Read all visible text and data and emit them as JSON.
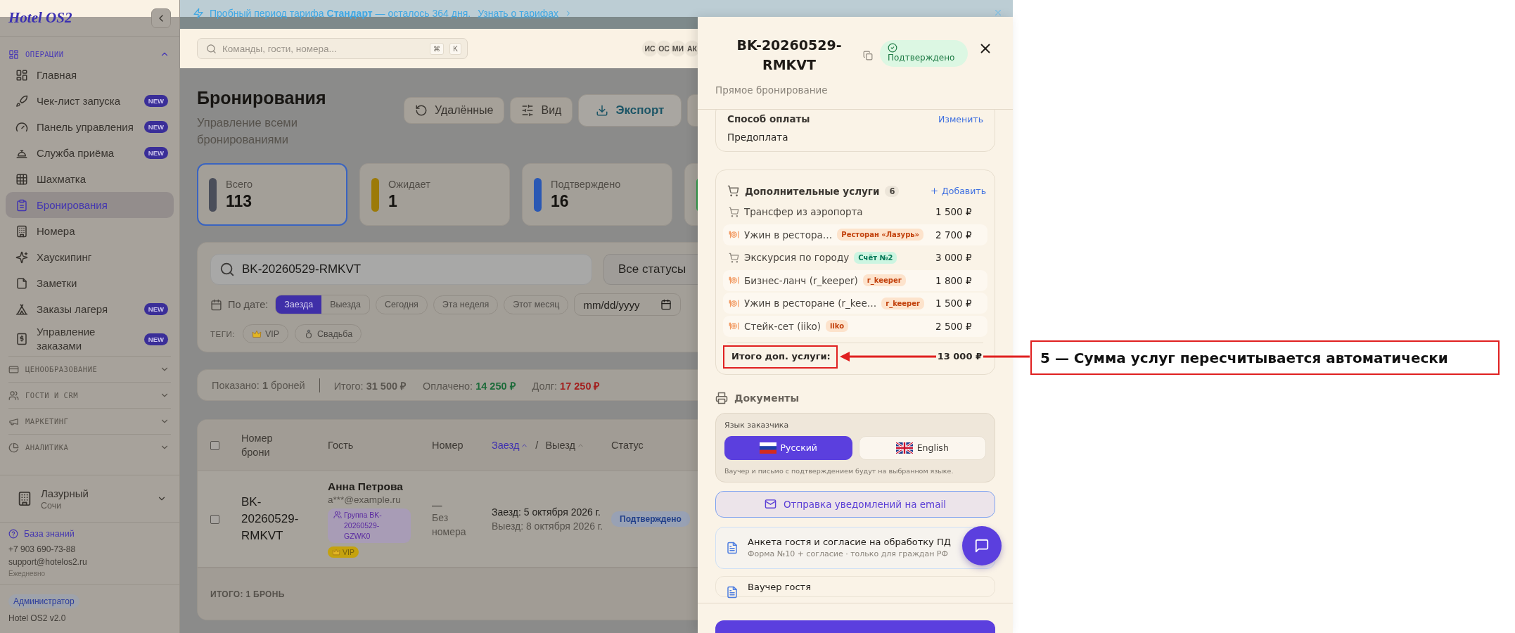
{
  "banner": {
    "text": "Пробный период тарифа **Стандарт** — осталось 364 дня.",
    "link": "Узнать о тарифах"
  },
  "sidebar": {
    "logo": "Hotel OS2",
    "sections": [
      {
        "label": "ОПЕРАЦИИ",
        "expanded": true,
        "items": [
          {
            "label": "Главная",
            "selected": false
          },
          {
            "label": "Чек-лист запуска",
            "selected": false,
            "badge": "NEW"
          },
          {
            "label": "Панель управления",
            "selected": false,
            "badge": "NEW"
          },
          {
            "label": "Служба приёма",
            "selected": false,
            "badge": "NEW"
          },
          {
            "label": "Шахматка",
            "selected": false
          },
          {
            "label": "Бронирования",
            "selected": true
          },
          {
            "label": "Номера",
            "selected": false
          },
          {
            "label": "Хаускипинг",
            "selected": false
          },
          {
            "label": "Заметки",
            "selected": false
          },
          {
            "label": "Заказы лагеря",
            "selected": false,
            "badge": "NEW"
          },
          {
            "label": "Управление заказами",
            "selected": false,
            "badge": "NEW"
          }
        ]
      },
      {
        "label": "ЦЕНООБРАЗОВАНИЕ",
        "expanded": false
      },
      {
        "label": "ГОСТИ И CRM",
        "expanded": false
      },
      {
        "label": "МАРКЕТИНГ",
        "expanded": false
      },
      {
        "label": "АНАЛИТИКА",
        "expanded": false
      }
    ],
    "property": {
      "name": "Лазурный",
      "city": "Сочи"
    },
    "support": {
      "link": "База знаний",
      "phone": "+7 903 690-73-88",
      "email": "support@hotelos2.ru",
      "hours": "Ежедневно"
    },
    "role": "Администратор",
    "version": "Hotel OS2 v2.0"
  },
  "topbar": {
    "search_placeholder": "Команды, гости, номера...",
    "keys": [
      "⌘",
      "K"
    ],
    "avatars": [
      "ИС",
      "ОС",
      "МИ",
      "АК"
    ]
  },
  "page": {
    "title": "Бронирования",
    "subtitle": "Управление всеми бронированиями",
    "actions": [
      {
        "kind": "restore",
        "label": "Удалённые"
      },
      {
        "kind": "view",
        "label": "Вид"
      },
      {
        "kind": "export",
        "label": "Экспорт"
      },
      {
        "kind": "more"
      }
    ]
  },
  "stats": [
    {
      "label": "Всего",
      "value": "113",
      "color": "#4a4e5a",
      "selected": true
    },
    {
      "label": "Ожидает",
      "value": "1",
      "color": "#9c7a08",
      "selected": false
    },
    {
      "label": "Подтверждено",
      "value": "16",
      "color": "#2a58b4",
      "selected": false
    },
    {
      "color": "#2f9a4a",
      "selected": false
    }
  ],
  "filters": {
    "search": "BK-20260529-RMKVT",
    "status": "Все статусы",
    "date_label": "По дате:",
    "date_modes": [
      {
        "label": "Заезда",
        "selected": true
      },
      {
        "label": "Выезда",
        "selected": false
      }
    ],
    "presets": [
      "Сегодня",
      "Эта неделя",
      "Этот месяц"
    ],
    "date_placeholder": "mm/dd/yyyy",
    "tags_label": "ТЕГИ:",
    "tags": [
      "VIP",
      "Свадьба"
    ]
  },
  "summary": [
    {
      "text": "Показано: **1** броней"
    },
    {
      "text": "Итого: **31 500 ₽**"
    },
    {
      "text": "Оплачено: **14 250 ₽**",
      "color": "#1d6b3a"
    },
    {
      "text": "Долг: **17 250 ₽**",
      "color": "#a3201f"
    }
  ],
  "table": {
    "columns": [
      {
        "kind": "check",
        "checked": false
      },
      {
        "kind": "text",
        "label": "Номер брони"
      },
      {
        "kind": "text",
        "label": "Гость"
      },
      {
        "kind": "text",
        "label": "Номер"
      },
      {
        "kind": "sort",
        "options": [
          {
            "label": "Заезд",
            "selected": true
          },
          {
            "label": "Выезд",
            "selected": false
          }
        ],
        "separator": "/"
      },
      {
        "kind": "text",
        "label": "Статус"
      }
    ],
    "rows": [
      {
        "checked": false,
        "booking": "BK-20260529-RMKVT",
        "guest": {
          "name": "Анна Петрова",
          "email": "a***@example.ru",
          "group": "Группа BK-20260529-GZWK0",
          "tags": [
            "VIP"
          ]
        },
        "room": {
          "number": "—",
          "note": "Без номера"
        },
        "checkin": "Заезд: 5 октября 2026 г.",
        "checkout": "Выезд: 8 октября 2026 г.",
        "status": "Подтверждено"
      }
    ],
    "footer": "ИТОГО: 1 БРОНЬ"
  },
  "drawer": {
    "title": "BK-20260529-RMKVT",
    "status": "Подтверждено",
    "source": "Прямое бронирование",
    "payment": {
      "title": "Способ оплаты",
      "action": "Изменить",
      "value": "Предоплата"
    },
    "services": {
      "title": "Дополнительные услуги",
      "count": "6",
      "action": "Добавить",
      "items": [
        {
          "kind": "service",
          "name": "Трансфер из аэропорта",
          "amount": "1 500 ₽"
        },
        {
          "kind": "restaurant",
          "name": "Ужин в рестора…",
          "tag": {
            "label": "Ресторан «Лазурь»",
            "kind": "pos"
          },
          "amount": "2 700 ₽"
        },
        {
          "kind": "service",
          "name": "Экскурсия по городу",
          "tag": {
            "label": "Счёт №2",
            "kind": "invoice"
          },
          "amount": "3 000 ₽"
        },
        {
          "kind": "restaurant",
          "name": "Бизнес-ланч (r_keeper)",
          "tag": {
            "label": "r_keeper",
            "kind": "pos"
          },
          "amount": "1 800 ₽"
        },
        {
          "kind": "restaurant",
          "name": "Ужин в ресторане (r_kee…",
          "tag": {
            "label": "r_keeper",
            "kind": "pos"
          },
          "amount": "1 500 ₽"
        },
        {
          "kind": "restaurant",
          "name": "Стейк-сет (iiko)",
          "tag": {
            "label": "iiko",
            "kind": "pos"
          },
          "amount": "2 500 ₽"
        }
      ],
      "total_label": "Итого доп. услуги:",
      "total": "13 000 ₽"
    },
    "documents": {
      "title": "Документы",
      "language_label": "Язык заказчика",
      "languages": [
        {
          "label": "Русский",
          "selected": true
        },
        {
          "label": "English",
          "selected": false
        }
      ],
      "language_note": "Ваучер и письмо с подтверждением будут на выбранном языке.",
      "email_button": "Отправка уведомлений на email",
      "items": [
        {
          "title": "Анкета гостя и согласие на обработку ПД",
          "subtitle": "Форма №10 + согласие · только для граждан РФ"
        },
        {
          "title": "Ваучер гостя"
        }
      ]
    }
  },
  "annotation": {
    "text": "5 — Сумма услуг пересчитывается автоматически"
  }
}
